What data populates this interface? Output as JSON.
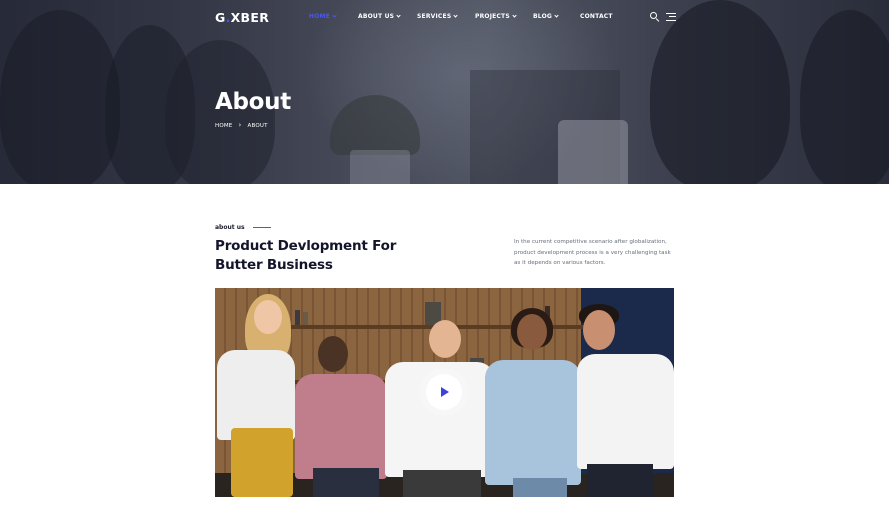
{
  "header": {
    "logo_prefix": "G",
    "logo_dot": ".",
    "logo_suffix": "XBER",
    "brand_color": "#4a55f0",
    "menu": [
      {
        "label": "HOME",
        "active": true,
        "has_dropdown": true
      },
      {
        "label": "ABOUT US",
        "active": false,
        "has_dropdown": true
      },
      {
        "label": "SERVICES",
        "active": false,
        "has_dropdown": true
      },
      {
        "label": "PROJECTS",
        "active": false,
        "has_dropdown": true
      },
      {
        "label": "BLOG",
        "active": false,
        "has_dropdown": true
      },
      {
        "label": "CONTACT",
        "active": false,
        "has_dropdown": false
      }
    ],
    "icons": [
      "search-icon",
      "menu-icon"
    ]
  },
  "hero": {
    "title": "About",
    "breadcrumb": [
      "HOME",
      "ABOUT"
    ],
    "breadcrumb_separator": "›"
  },
  "about": {
    "eyebrow": "about us",
    "title": "Product Devlopment For Butter Business",
    "description": "In the current competitive scenario after globalization, product development process is a very challenging task as it depends on various factors."
  },
  "video": {
    "icon": "play-icon",
    "play_color": "#3b44d6"
  }
}
